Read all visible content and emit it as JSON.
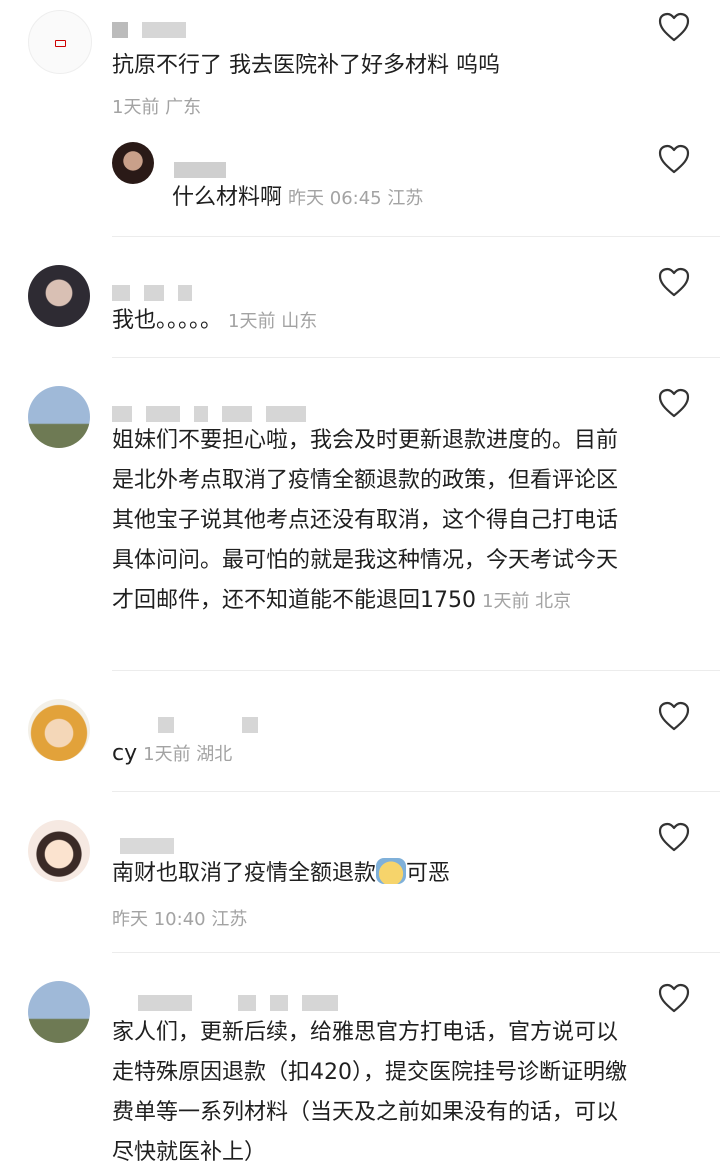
{
  "comments": [
    {
      "text": "抗原不行了 我去医院补了好多材料 呜呜",
      "meta": "1天前 广东"
    },
    {
      "text": "什么材料啊",
      "meta": "昨天 06:45 江苏"
    },
    {
      "text": "我也。。。。。",
      "meta": "1天前 山东"
    },
    {
      "text": "姐妹们不要担心啦，我会及时更新退款进度的。目前是北外考点取消了疫情全额退款的政策，但看评论区其他宝子说其他考点还没有取消，这个得自己打电话具体问问。最可怕的就是我这种情况，今天考试今天才回邮件，还不知道能不能退回1750",
      "meta": "1天前 北京"
    },
    {
      "text": "cy",
      "meta": "1天前 湖北"
    },
    {
      "text": "南财也取消了疫情全额退款",
      "text_after": "可恶",
      "meta": "昨天 10:40 江苏"
    },
    {
      "text": "家人们，更新后续，给雅思官方打电话，官方说可以走特殊原因退款（扣420），提交医院挂号诊断证明缴费单等一系列材料（当天及之前如果没有的话，可以尽快就医补上）",
      "meta": ""
    }
  ],
  "icons": {
    "like": "heart-outline-icon",
    "emoji": "crying-face-emoji-icon"
  }
}
